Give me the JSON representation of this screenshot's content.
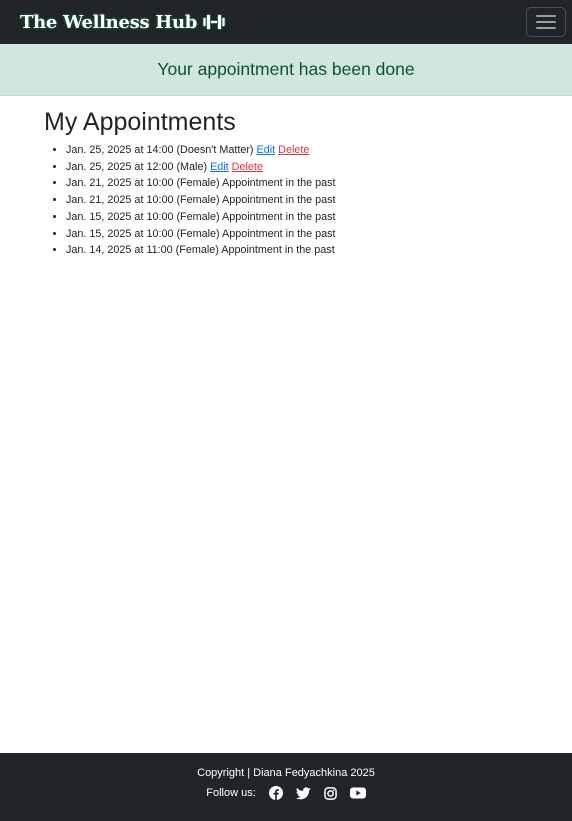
{
  "navbar": {
    "brand": "The Wellness Hub",
    "brand_icon": "dumbbell-icon",
    "menu_icon": "hamburger-menu-icon"
  },
  "alert": {
    "message": "Your appointment has been done",
    "background": "#d1e7dd",
    "text_color": "#0f5132"
  },
  "main": {
    "title": "My Appointments",
    "appointments": [
      {
        "text": "Jan. 25, 2025 at 14:00 (Doesn't Matter)",
        "edit": "Edit",
        "delete": "Delete"
      },
      {
        "text": "Jan. 25, 2025 at 12:00 (Male)",
        "edit": "Edit",
        "delete": "Delete"
      },
      {
        "text": "Jan. 21, 2025 at 10:00 (Female) Appointment in the past"
      },
      {
        "text": "Jan. 21, 2025 at 10:00 (Female) Appointment in the past"
      },
      {
        "text": "Jan. 15, 2025 at 10:00 (Female) Appointment in the past"
      },
      {
        "text": "Jan. 15, 2025 at 10:00 (Female) Appointment in the past"
      },
      {
        "text": "Jan. 14, 2025 at 11:00 (Female) Appointment in the past"
      }
    ]
  },
  "footer": {
    "copyright": "Copyright | Diana Fedyachkina 2025",
    "follow_label": "Follow us:",
    "social_icons": [
      "facebook-icon",
      "twitter-icon",
      "instagram-icon",
      "youtube-icon"
    ]
  },
  "colors": {
    "navbar_bg": "#212529",
    "link": "#0d6efd",
    "delete": "#dc3545"
  }
}
